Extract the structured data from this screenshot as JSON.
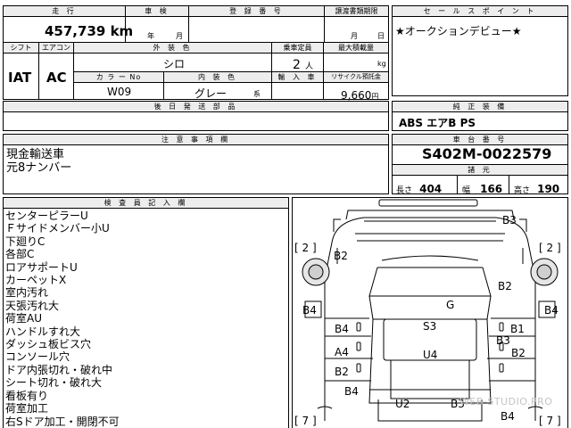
{
  "top": {
    "headers": {
      "mileage": "走 行",
      "inspection": "車 検",
      "registration": "登 録 番 号",
      "transfer_deadline": "譲渡書類期限",
      "sales_point": "セ ー ル ス ポ イ ン ト"
    },
    "mileage_value": "457,739",
    "mileage_unit": "km",
    "year_unit": "年",
    "month_unit": "月",
    "deadline_month": "月",
    "deadline_day": "日",
    "sales_point_text": "★オークションデビュー★"
  },
  "mid": {
    "headers": {
      "shift": "シフト",
      "aircon": "エアコン",
      "exterior_color": "外 装 色",
      "capacity": "乗車定員",
      "max_load": "最大積載量",
      "color_no": "カ ラ ー No",
      "interior_color": "内 装 色",
      "import": "輸 入 車",
      "recycle": "リサイクル預託金"
    },
    "shift_value": "IAT",
    "aircon_value": "AC",
    "exterior_color_value": "シロ",
    "capacity_value": "2",
    "capacity_unit": "人",
    "max_load_unit": "kg",
    "color_no_value": "W09",
    "interior_color_value": "グレー",
    "interior_suffix": "系",
    "recycle_value": "9,660",
    "recycle_unit": "円"
  },
  "later_parts": {
    "header": "後 日 発 送 部 品",
    "value": ""
  },
  "equipment": {
    "header": "純 正 装 備",
    "value": "ABS エアB PS"
  },
  "notes": {
    "header": "注 意 事 項 欄",
    "lines": [
      "現金輸送車",
      "元8ナンバー"
    ]
  },
  "chassis": {
    "header": "車 台 番 号",
    "value": "S402M-0022579"
  },
  "specs": {
    "header": "諸 元",
    "length_label": "長さ",
    "length_value": "404",
    "width_label": "幅",
    "width_value": "166",
    "height_label": "高さ",
    "height_value": "190"
  },
  "inspector": {
    "header": "検 査 員 記 入 欄",
    "lines": [
      "センターピラーU",
      "Ｆサイドメンバー小U",
      "下廻りC",
      "各部C",
      "ロアサポートU",
      "カーペットX",
      "室内汚れ",
      "天張汚れ大",
      "荷室AU",
      "ハンドルすれ大",
      "ダッシュ板ビス穴",
      "コンソール穴",
      "ドア内張切れ・破れ中",
      "シート切れ・破れ大",
      "看板有り",
      "荷室加工",
      "右Sドア加工・開閉不可"
    ]
  },
  "diagram": {
    "codes": {
      "b3_top": "B3",
      "b2_left_top": "B2",
      "b2_right_mid": "B2",
      "g": "G",
      "b4_left": "B4",
      "b4_right": "B4",
      "b4_mid_left": "B4",
      "s3": "S3",
      "b1": "B1",
      "b3_mid": "B3",
      "a4": "A4",
      "u4": "U4",
      "b2_right_low": "B2",
      "b2_left_low": "B2",
      "b4_left_low": "B4",
      "u2": "U2",
      "b3_bottom": "B3",
      "b4_bottom": "B4"
    },
    "brackets": {
      "left_top": "[ 2 ]",
      "right_top": "[ 2 ]",
      "left_bottom": "[ 7 ]",
      "right_bottom": "[ 7 ]"
    },
    "watermark": "WEB-STUDIO.PRO"
  }
}
